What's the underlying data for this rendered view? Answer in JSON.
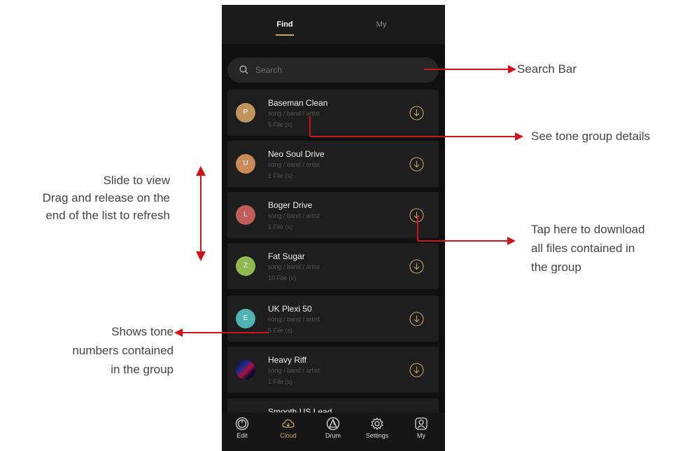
{
  "tabs": {
    "find": "Find",
    "my": "My"
  },
  "search": {
    "placeholder": "Search"
  },
  "tone_groups": [
    {
      "initial": "P",
      "name": "Baseman Clean",
      "meta": "song / band / artist",
      "files": "5 File (s)",
      "color": "#c0955c"
    },
    {
      "initial": "U",
      "name": "Neo Soul Drive",
      "meta": "song / band / artist",
      "files": "1 File (s)",
      "color": "#c98a57"
    },
    {
      "initial": "L",
      "name": "Boger Drive",
      "meta": "song / band / artist",
      "files": "1 File (s)",
      "color": "#c15e5c"
    },
    {
      "initial": "Z",
      "name": "Fat Sugar",
      "meta": "song / band / artist",
      "files": "10 File (s)",
      "color": "#8fba52"
    },
    {
      "initial": "E",
      "name": "UK Plexi 50",
      "meta": "song / band / artist",
      "files": "5 File (s)",
      "color": "#4fb4b2"
    },
    {
      "initial": "",
      "name": "Heavy Riff",
      "meta": "song / band / artist",
      "files": "1 File (s)",
      "color": "#1b1b3a"
    },
    {
      "initial": "",
      "name": "Smooth US Lead",
      "meta": "",
      "files": "",
      "color": "#1b1b1b"
    }
  ],
  "bottom_nav": [
    {
      "label": "Edit",
      "icon": "knob-icon"
    },
    {
      "label": "Cloud",
      "icon": "cloud-icon"
    },
    {
      "label": "Drum",
      "icon": "drum-icon"
    },
    {
      "label": "Settings",
      "icon": "gear-icon"
    },
    {
      "label": "My",
      "icon": "user-icon"
    }
  ],
  "annotations": {
    "search_bar": "Search Bar",
    "tone_details": "See tone group details",
    "slide_line1": "Slide to view",
    "slide_line2": "Drag and release on the",
    "slide_line3": "end of the list to refresh",
    "download_line1": "Tap here to download",
    "download_line2": "all files contained in",
    "download_line3": "the group",
    "numbers_line1": "Shows tone",
    "numbers_line2": "numbers contained",
    "numbers_line3": "in the group"
  },
  "colors": {
    "accent": "#c9a363",
    "annotation_arrow": "#d0121b",
    "background": "#0f0f0f"
  }
}
